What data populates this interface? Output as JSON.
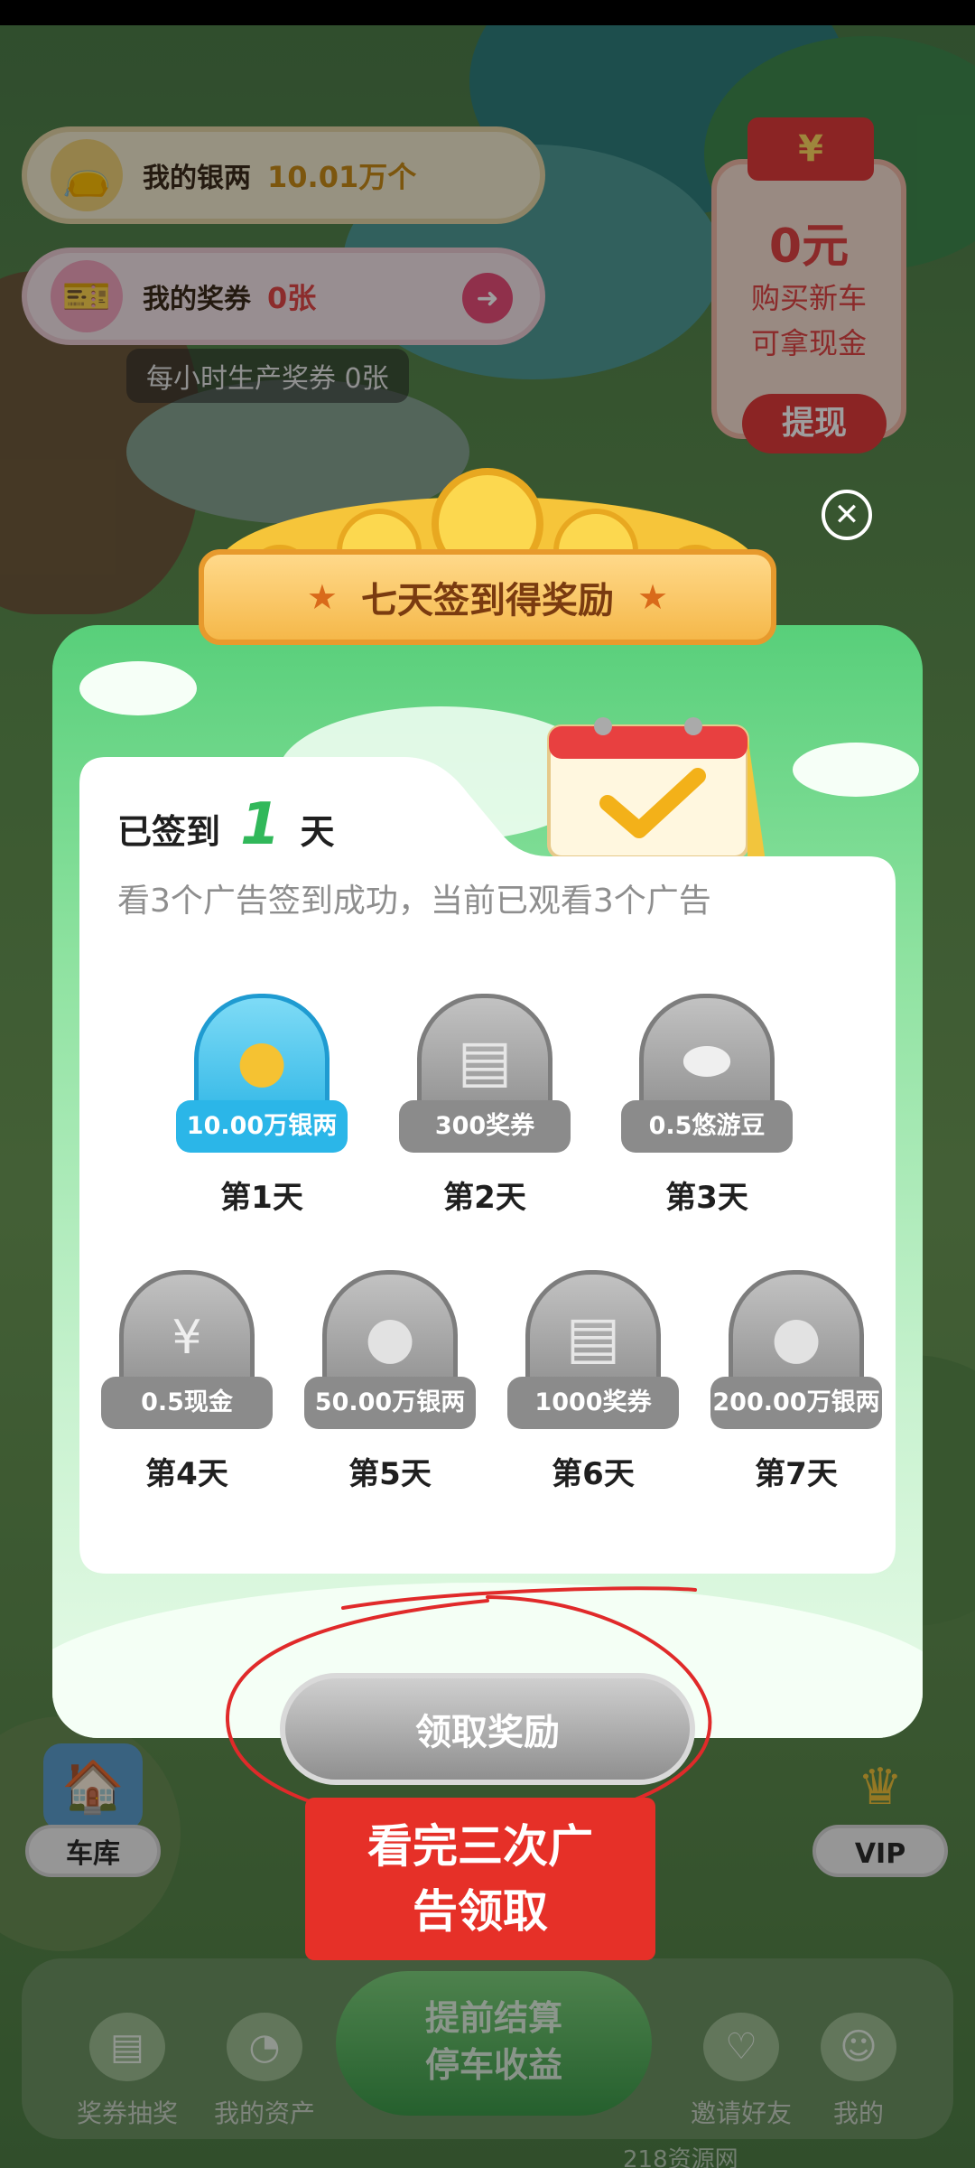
{
  "hud": {
    "silver_label": "我的银两",
    "silver_value": "10.01万个",
    "coupon_label": "我的奖券",
    "coupon_value": "0张",
    "hourly_text": "每小时生产奖券 0张"
  },
  "cash_card": {
    "envelope_char": "¥",
    "amount": "0元",
    "line1": "购买新车",
    "line2": "可拿现金",
    "withdraw": "提现"
  },
  "modal": {
    "title": "七天签到得奖励",
    "signed_prefix": "已签到",
    "signed_count": "1",
    "signed_suffix": "天",
    "hint": "看3个广告签到成功，当前已观看3个广告",
    "days": [
      {
        "reward": "10.00万银两",
        "label": "第1天",
        "icon": "coin-stack-icon",
        "active": true
      },
      {
        "reward": "300奖券",
        "label": "第2天",
        "icon": "coupon-stack-icon",
        "active": false
      },
      {
        "reward": "0.5悠游豆",
        "label": "第3天",
        "icon": "bean-icon",
        "active": false
      },
      {
        "reward": "0.5现金",
        "label": "第4天",
        "icon": "cash-icon",
        "active": false
      },
      {
        "reward": "50.00万银两",
        "label": "第5天",
        "icon": "coin-pile-icon",
        "active": false
      },
      {
        "reward": "1000奖券",
        "label": "第6天",
        "icon": "coupon-fan-icon",
        "active": false
      },
      {
        "reward": "200.00万银两",
        "label": "第7天",
        "icon": "coin-heap-icon",
        "active": false
      }
    ],
    "claim_button": "领取奖励"
  },
  "annotation": {
    "line1": "看完三次广",
    "line2": "告领取"
  },
  "side": {
    "garage": "车库",
    "vip": "VIP"
  },
  "bottom_nav": {
    "lottery": "奖券抽奖",
    "assets": "我的资产",
    "settle_line1": "提前结算",
    "settle_line2": "停车收益",
    "invite": "邀请好友",
    "mine": "我的"
  },
  "watermark": "218资源网",
  "colors": {
    "modal_green": "#58cf7a",
    "active_blue": "#2bb6e8",
    "annotation_red": "#e63028",
    "silver_gold": "#c98b17"
  }
}
